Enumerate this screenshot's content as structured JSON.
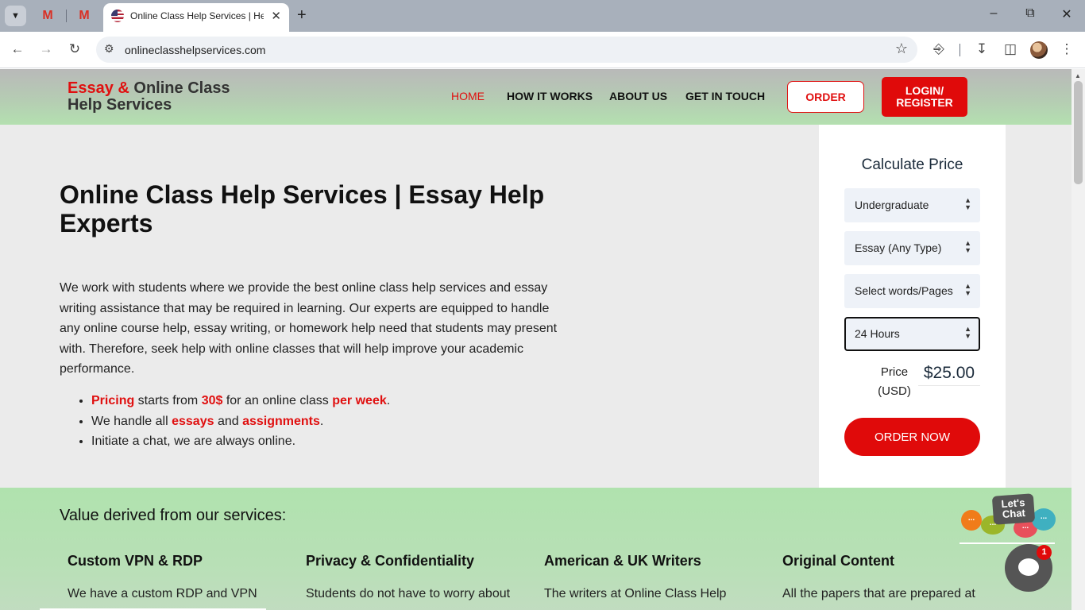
{
  "browser": {
    "active_tab_title": "Online Class Help Services | Help",
    "url": "onlineclasshelpservices.com",
    "gmail_glyph": "M"
  },
  "header": {
    "logo_red": "Essay &",
    "logo_rest_line1": "Online Class",
    "logo_line2": "Help Services",
    "nav": [
      "HOME",
      "HOW IT WORKS",
      "ABOUT US",
      "GET IN TOUCH"
    ],
    "order_label": "ORDER",
    "login_line1": "LOGIN/",
    "login_line2": "REGISTER"
  },
  "hero": {
    "title": "Online Class Help Services | Essay Help Experts",
    "intro": "We work with students where we provide the best online class help services and essay writing assistance that may be required in learning. Our experts are equipped to handle any online course help, essay writing, or homework help need that students may present with. Therefore, seek help with online classes that will help improve your academic performance.",
    "bullet1": {
      "a": "Pricing",
      "b": " starts from ",
      "c": "30$",
      "d": " for an online class ",
      "e": "per week",
      "f": "."
    },
    "bullet2": {
      "a": "We handle all ",
      "b": "essays",
      "c": " and ",
      "d": "assignments",
      "e": "."
    },
    "bullet3": "Initiate a chat, we are always online."
  },
  "calculator": {
    "title": "Calculate Price",
    "level": "Undergraduate",
    "paper_type": "Essay (Any Type)",
    "pages": "Select words/Pages",
    "deadline": "24 Hours",
    "price_label_1": "Price",
    "price_label_2": "(USD)",
    "price_value": "$25.00",
    "order_now": "ORDER NOW"
  },
  "values": {
    "heading": "Value derived from our services:",
    "columns": [
      {
        "title": "Custom VPN & RDP",
        "text": "We have a custom RDP and VPN"
      },
      {
        "title": "Privacy & Confidentiality",
        "text": "Students do not have to worry about"
      },
      {
        "title": "American & UK Writers",
        "text": "The writers at Online Class Help"
      },
      {
        "title": "Original Content",
        "text": "All the papers that are prepared at"
      }
    ]
  },
  "chat": {
    "lets": "Let's",
    "chat": "Chat",
    "badge": "1",
    "dots": "..."
  },
  "colors": {
    "accent_red": "#e00a0a",
    "header_green": "#b4e0b0",
    "hero_bg": "#ebebeb"
  }
}
